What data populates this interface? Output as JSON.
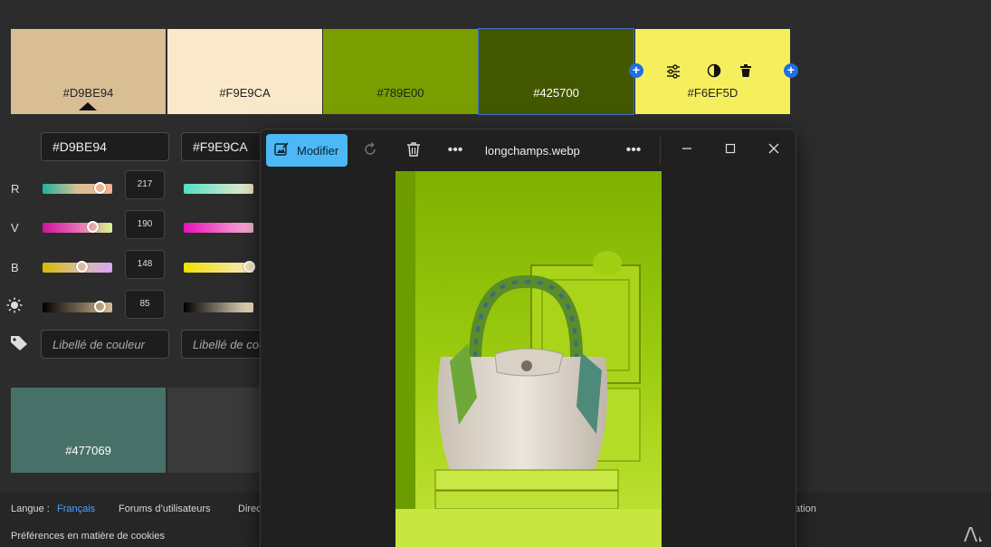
{
  "swatches": [
    {
      "hex": "#D9BE94",
      "color": "#D9BE94",
      "selected_marker": true
    },
    {
      "hex": "#F9E9CA",
      "color": "#F9E9CA"
    },
    {
      "hex": "#789E00",
      "color": "#789E00"
    },
    {
      "hex": "#425700",
      "color": "#425700"
    },
    {
      "hex": "#F6EF5D",
      "color": "#F6EF5D"
    }
  ],
  "editor": {
    "hex_values": [
      "#D9BE94",
      "#F9E9CA"
    ],
    "row_labels": {
      "r": "R",
      "v": "V",
      "b": "B"
    },
    "values": {
      "r": "217",
      "v": "190",
      "b": "148",
      "brightness": "85"
    },
    "label_placeholder": "Libellé de couleur",
    "label_placeholder_cut": "Libellé de cou"
  },
  "bottom_swatch": {
    "hex": "#477069",
    "color": "#477069"
  },
  "footer": {
    "language_label": "Langue :",
    "language_value": "Français",
    "forums": "Forums d’utilisateurs",
    "cut_link": "Direc",
    "cut_link_right": "ation",
    "cookies": "Préférences en matière de cookies"
  },
  "viewer": {
    "edit_label": "Modifier",
    "filename": "longchamps.webp"
  },
  "colors": {
    "accent": "#4cb8f5",
    "plus": "#1f6fe5",
    "language": "#4da3ff"
  }
}
